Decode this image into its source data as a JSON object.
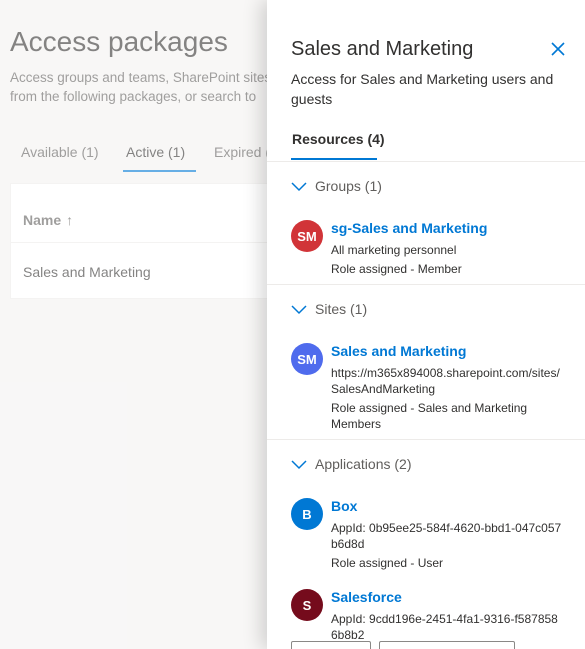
{
  "background": {
    "title": "Access packages",
    "description_line1": "Access groups and teams, SharePoint sites",
    "description_line2": "from the following packages, or search to",
    "tabs": [
      {
        "label": "Available (1)"
      },
      {
        "label": "Active (1)"
      },
      {
        "label": "Expired ("
      }
    ],
    "table": {
      "column_header": "Name",
      "sort_icon": "arrow-up-icon",
      "rows": [
        {
          "name": "Sales and Marketing"
        }
      ]
    }
  },
  "panel": {
    "title": "Sales and Marketing",
    "subtitle": "Access for Sales and Marketing users and guests",
    "close_icon": "close-icon",
    "tab_label": "Resources (4)",
    "accent_color": "#0078d4",
    "sections": {
      "groups": {
        "label": "Groups (1)",
        "items": [
          {
            "initials": "SM",
            "name": "sg-Sales and Marketing",
            "line1": "All marketing personnel",
            "line2": "Role assigned - Member",
            "color": "#d13438"
          }
        ]
      },
      "sites": {
        "label": "Sites (1)",
        "items": [
          {
            "initials": "SM",
            "name": "Sales and Marketing",
            "line1": "https://m365x894008.sharepoint.com/sites/SalesAndMarketing",
            "line2": "Role assigned - Sales and Marketing Members",
            "color": "#4f6bed"
          }
        ]
      },
      "applications": {
        "label": "Applications (2)",
        "items": [
          {
            "initials": "B",
            "name": "Box",
            "line1": "AppId: 0b95ee25-584f-4620-bbd1-047c057b6d8d",
            "line2": "Role assigned - User",
            "color": "#0078d4"
          },
          {
            "initials": "S",
            "name": "Salesforce",
            "line1": "AppId: 9cdd196e-2451-4fa1-9316-f5878586b8b2",
            "color": "#750b1c"
          }
        ]
      }
    }
  }
}
